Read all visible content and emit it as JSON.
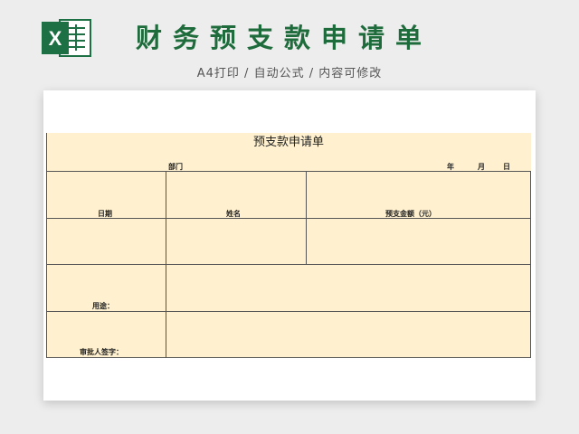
{
  "banner": {
    "title": "财务预支款申请单",
    "subtitle": "A4打印 / 自动公式 / 内容可修改",
    "logo_letter": "X",
    "colors": {
      "brand_green": "#1e6b3c",
      "logo_green": "#1d7044",
      "form_fill": "#fff1cf"
    }
  },
  "form": {
    "title": "预支款申请单",
    "department_label": "部门",
    "year_label": "年",
    "month_label": "月",
    "day_label": "日",
    "date_header": "日期",
    "name_header": "姓名",
    "amount_header": "预支金额（元）",
    "purpose_label": "用途：",
    "approver_label": "审批人签字："
  }
}
